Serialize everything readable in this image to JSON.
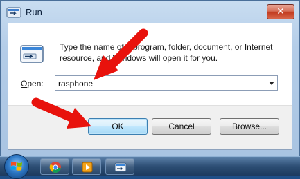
{
  "window": {
    "title": "Run",
    "close_label": "✕"
  },
  "dialog": {
    "description": "Type the name of a program, folder, document, or Internet resource, and Windows will open it for you.",
    "open_label_accel": "O",
    "open_label_rest": "pen:",
    "input_value": "rasphone",
    "ok_label": "OK",
    "cancel_label": "Cancel",
    "browse_label": "Browse..."
  },
  "taskbar": {
    "items": [
      "start-orb",
      "chrome-icon",
      "media-player-icon",
      "run-icon"
    ]
  },
  "annotation": {
    "arrow_color": "#e8120c",
    "arrow_count": 2
  },
  "colors": {
    "ok_border": "#3c7fb1",
    "close_red": "#c23c20"
  }
}
